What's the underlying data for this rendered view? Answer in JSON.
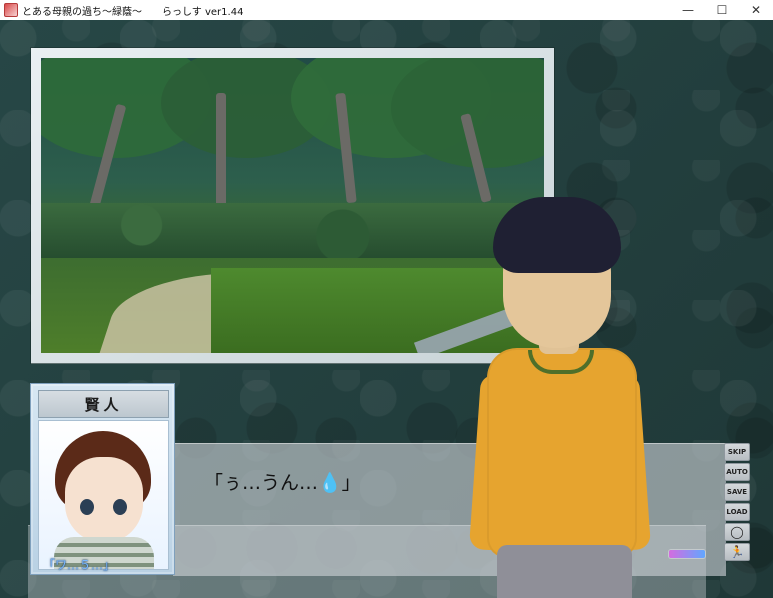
{
  "window": {
    "title": "とある母親の過ち～緑蔭～　　らっしす ver1.44",
    "minimize": "—",
    "maximize": "☐",
    "close": "✕"
  },
  "scene": {
    "description": ""
  },
  "portrait": {
    "name": "賢人",
    "label": "「ワ…５…」"
  },
  "dialogue": {
    "text": "「ぅ…うん…💧」"
  },
  "side_menu": {
    "skip": "SKIP",
    "auto": "AUTO",
    "save": "SAVE",
    "load": "LOAD",
    "circle_icon": "◯",
    "exit_icon": "🏃"
  }
}
